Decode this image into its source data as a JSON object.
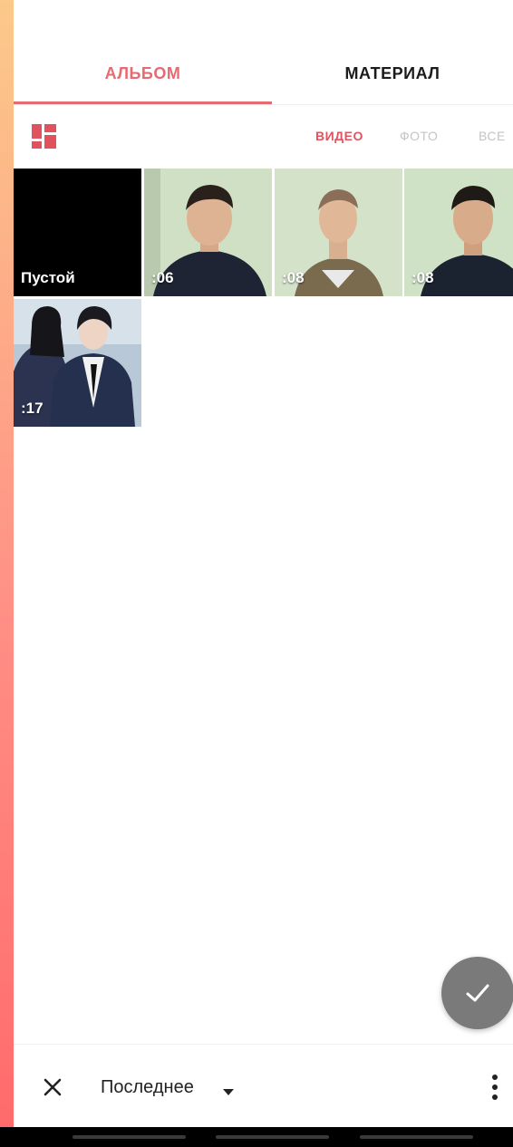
{
  "tabs": [
    {
      "label": "АЛЬБОМ",
      "active": true
    },
    {
      "label": "МАТЕРИАЛ",
      "active": false
    }
  ],
  "filters": [
    {
      "label": "ВИДЕО",
      "active": true
    },
    {
      "label": "ФОТО",
      "active": false
    },
    {
      "label": "ВСЕ",
      "active": false
    }
  ],
  "grid": {
    "items": [
      {
        "label": "Пустой",
        "kind": "empty"
      },
      {
        "label": ":06",
        "kind": "video"
      },
      {
        "label": ":08",
        "kind": "video"
      },
      {
        "label": ":08",
        "kind": "video"
      },
      {
        "label": ":17",
        "kind": "video"
      }
    ]
  },
  "bottom_bar": {
    "sort_label": "Последнее",
    "close_icon": "close-icon",
    "more_icon": "more-vertical-icon"
  },
  "fab": {
    "icon": "check-icon"
  },
  "colors": {
    "accent": "#e66a72",
    "fab": "#7a7a7a",
    "inactive": "#c4c4c4"
  }
}
